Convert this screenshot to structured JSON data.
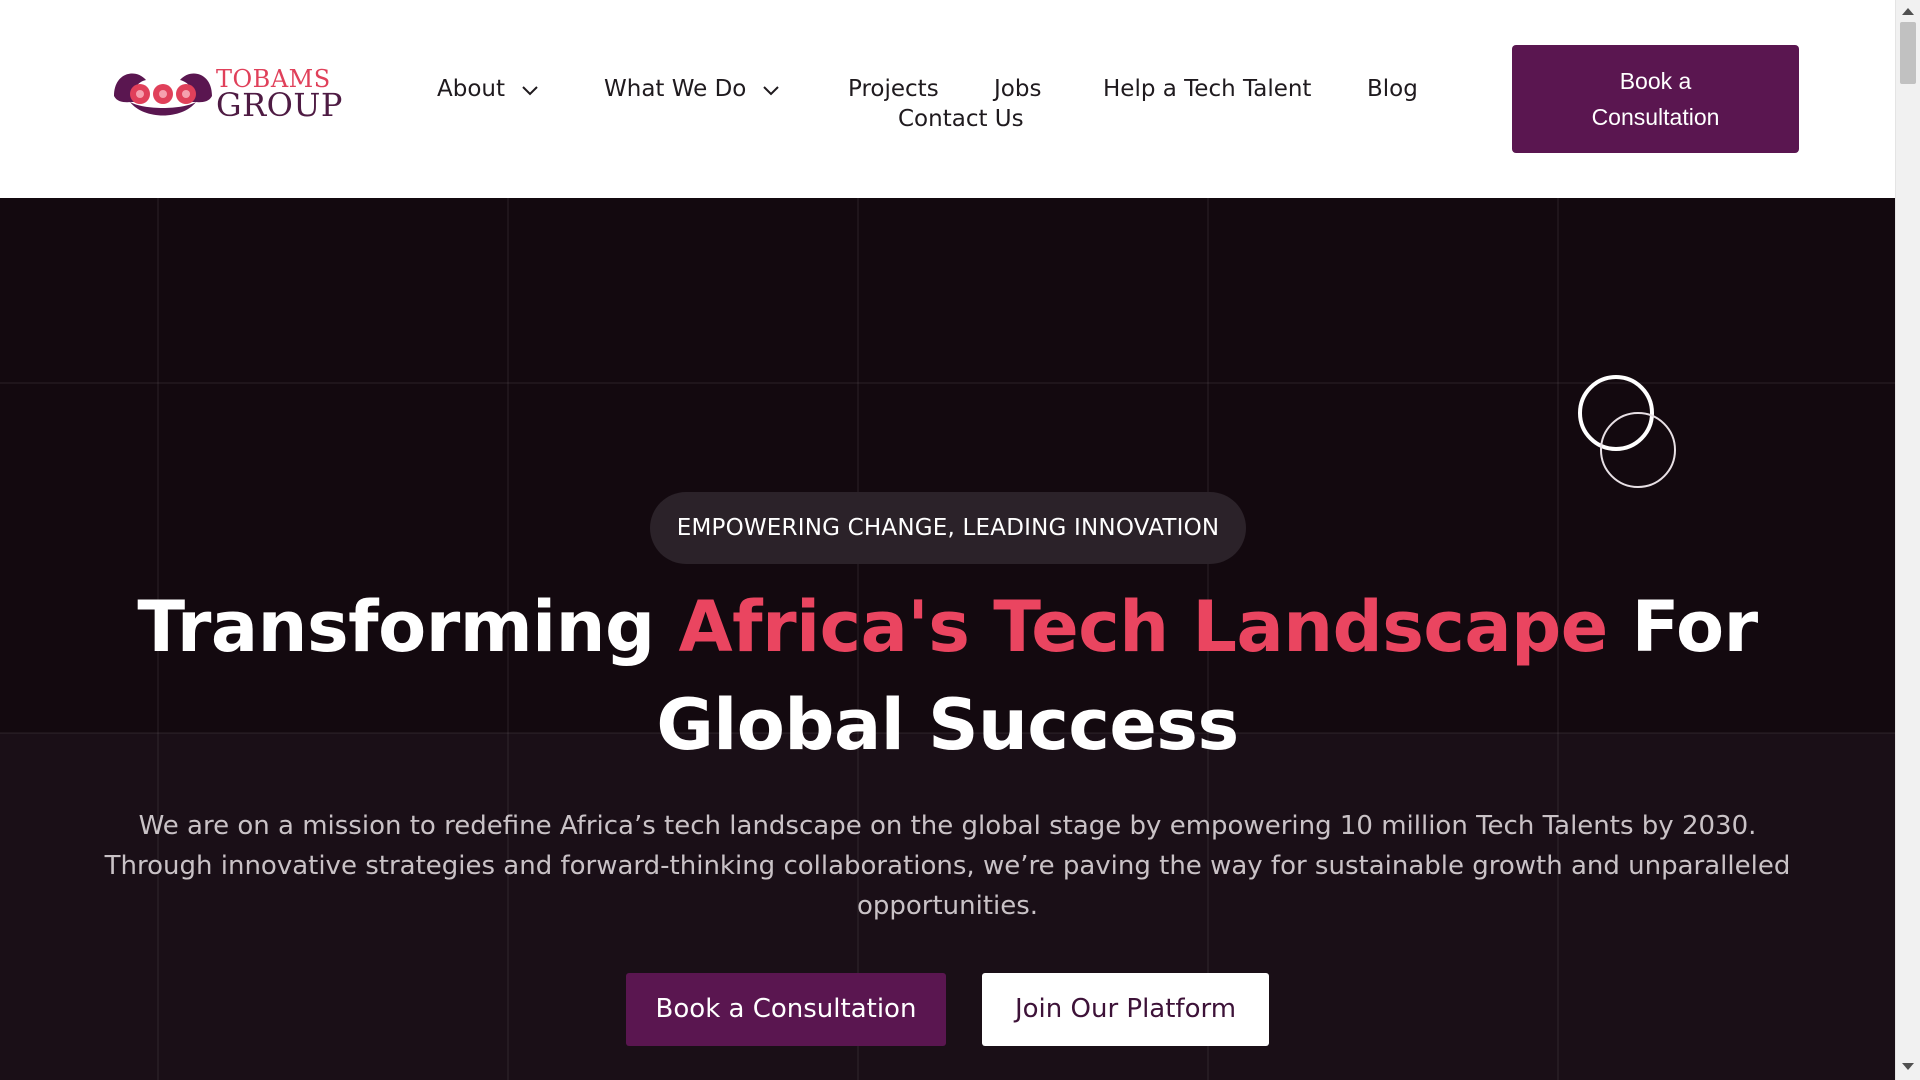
{
  "brand": {
    "name_top": "TOBAMS",
    "name_bottom": "GROUP",
    "colors": {
      "primary": "#5a1650",
      "accent": "#ea4560",
      "logo_dark": "#4e1b43"
    }
  },
  "nav": {
    "items": [
      {
        "label": "About",
        "has_dropdown": true
      },
      {
        "label": "What We Do",
        "has_dropdown": true
      },
      {
        "label": "Projects",
        "has_dropdown": false
      },
      {
        "label": "Jobs",
        "has_dropdown": false
      },
      {
        "label": "Help a Tech Talent",
        "has_dropdown": false
      },
      {
        "label": "Blog",
        "has_dropdown": false
      },
      {
        "label": "Contact Us",
        "has_dropdown": false
      }
    ],
    "cta_line1": "Book a",
    "cta_line2": "Consultation"
  },
  "hero": {
    "tagline": "EMPOWERING CHANGE, LEADING INNOVATION",
    "headline_part1": "Transforming ",
    "headline_accent": "Africa's Tech Landscape",
    "headline_part2": " For Global Success",
    "subtext": "We are on a mission to redefine Africa’s tech landscape on the global stage by empowering 10 million Tech Talents by 2030. Through innovative strategies and forward-thinking collaborations, we’re paving the way for sustainable growth and unparalleled opportunities.",
    "primary_button": "Book a Consultation",
    "secondary_button": "Join Our Platform",
    "colors": {
      "background": "#13090f",
      "pill": "#2b2229",
      "subtext": "#c9c2c6"
    }
  },
  "icons": {
    "dropdown": "chevron-down-icon",
    "decor": "double-ring-icon"
  }
}
